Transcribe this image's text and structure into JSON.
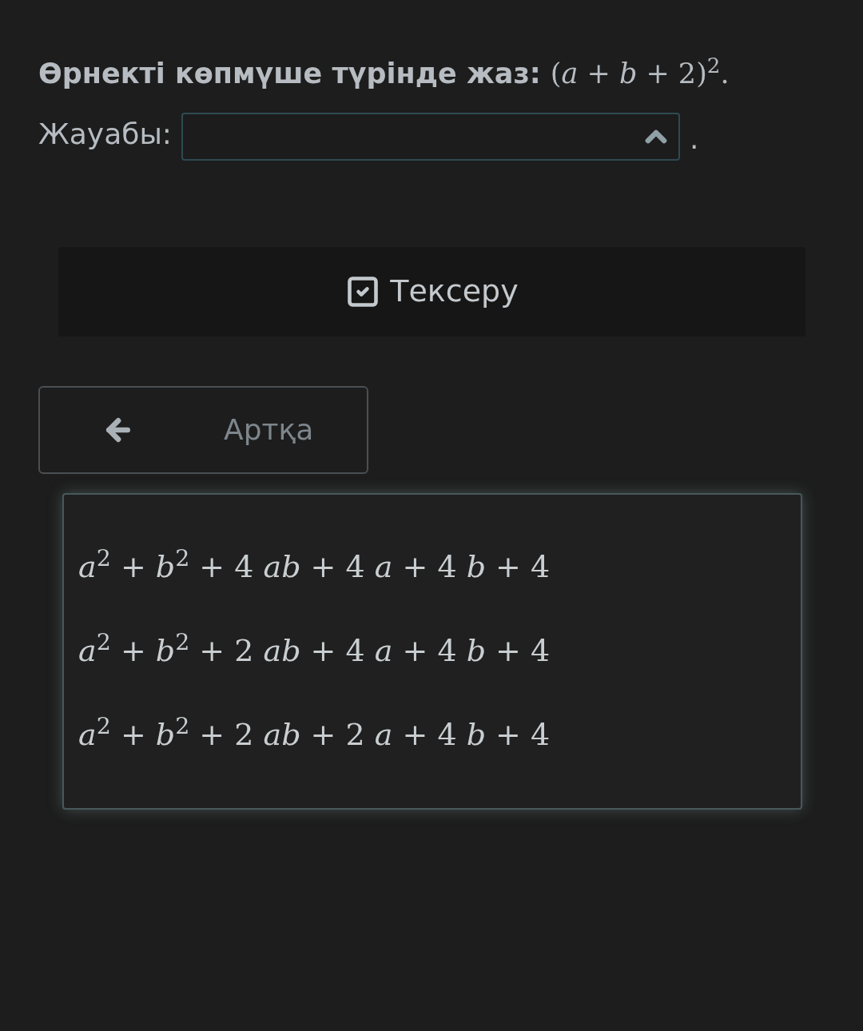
{
  "question": {
    "label": "Өрнекті көпмүше түрінде жаз:",
    "expression": "(*a* + *b* + 2)$^{2}$."
  },
  "answer": {
    "label": "Жауабы:",
    "expanded": true,
    "suffix": "."
  },
  "check_button": {
    "label": "Тексеру"
  },
  "back_button": {
    "label": "Артқа"
  },
  "options": [
    {
      "text": "*a*$^{2}$ + *b*$^{2}$ + 4 *ab* + 4 *a* + 4 *b* + 4",
      "selected": false
    },
    {
      "text": "*a*$^{2}$ + *b*$^{2}$ + 2 *ab* + 4 *a* + 4 *b* + 4",
      "selected": false
    },
    {
      "text": "*a*$^{2}$ + *b*$^{2}$ + 2 *ab* + 2 *a* + 4 *b* + 4",
      "selected": false
    }
  ]
}
